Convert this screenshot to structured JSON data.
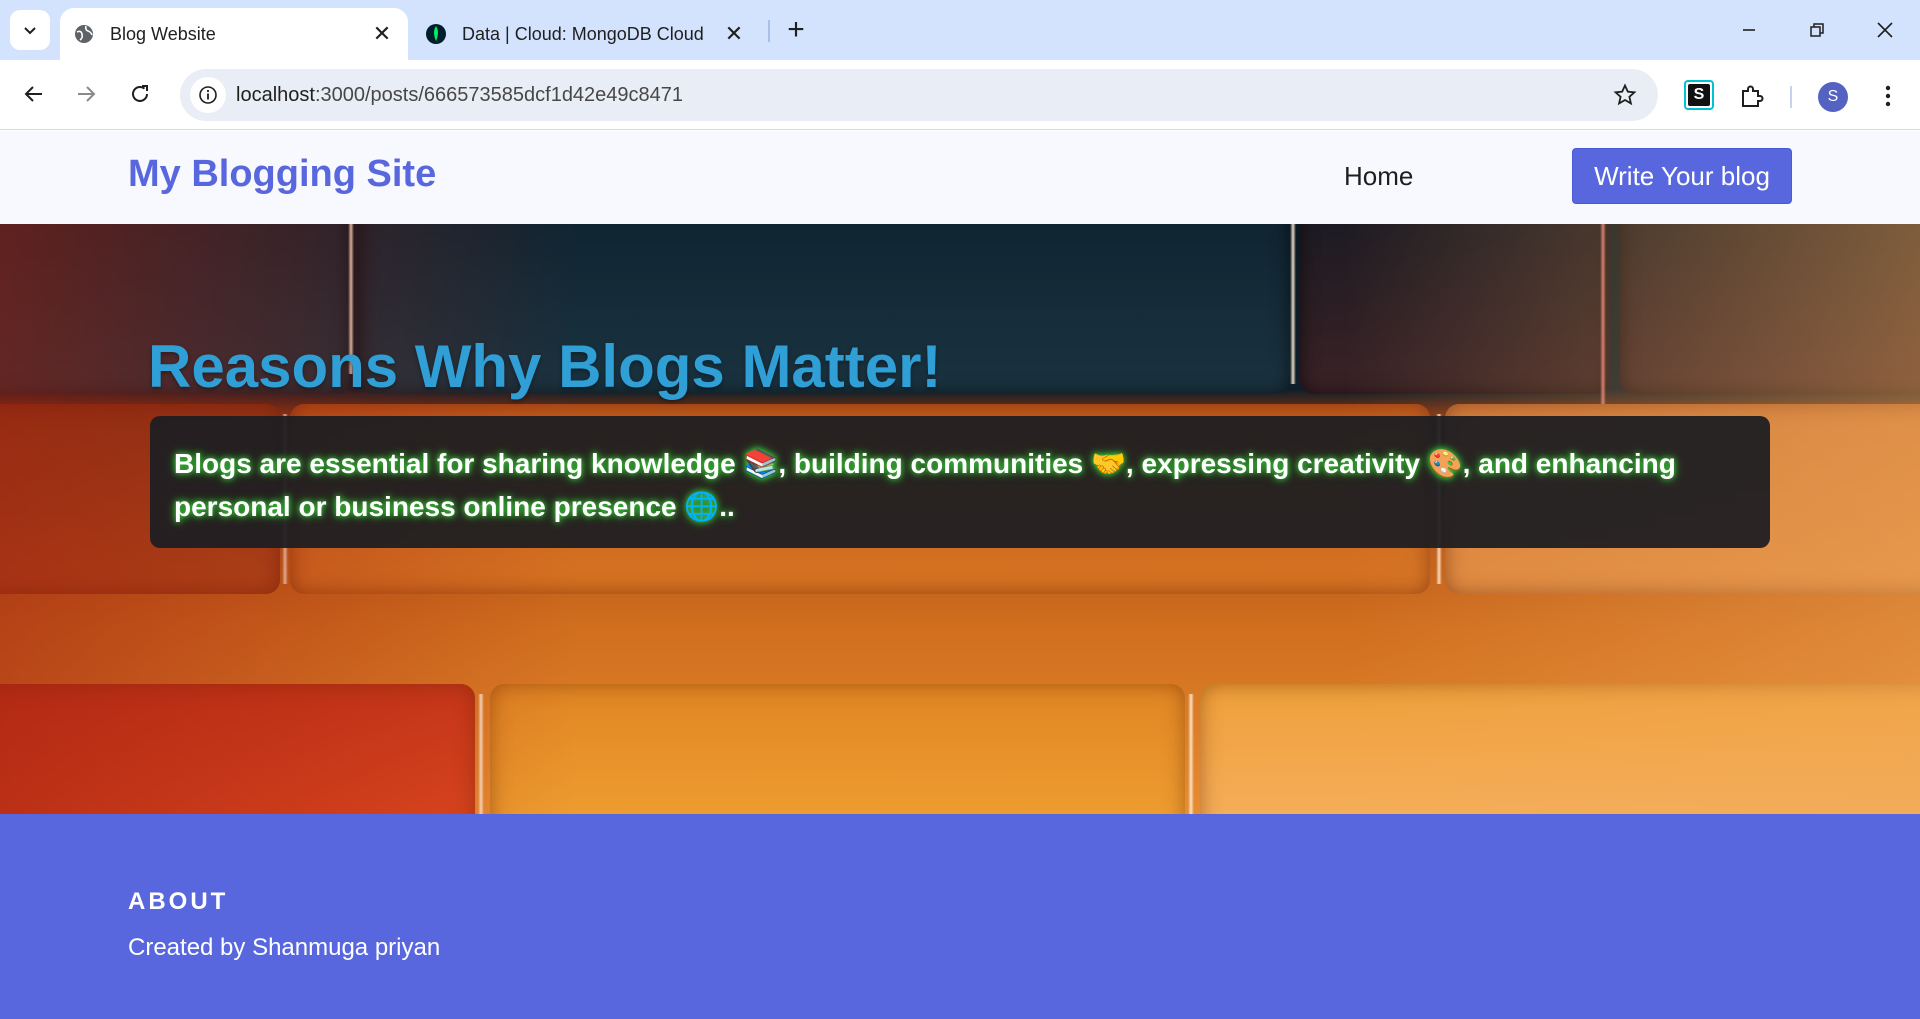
{
  "browser": {
    "tabs": [
      {
        "title": "Blog Website",
        "favicon": "globe-icon",
        "active": true
      },
      {
        "title": "Data | Cloud: MongoDB Cloud",
        "favicon": "mongodb-leaf-icon",
        "active": false
      }
    ],
    "url": {
      "host": "localhost",
      "path": ":3000/posts/666573585dcf1d42e49c8471"
    },
    "profile_initial": "S",
    "extension_label": "S"
  },
  "site": {
    "brand": "My Blogging Site",
    "nav": {
      "home": "Home",
      "write_button": "Write Your blog"
    }
  },
  "post": {
    "title": "Reasons Why Blogs Matter!",
    "body": "Blogs are essential for sharing knowledge 📚, building communities 🤝, expressing creativity 🎨, and enhancing personal or business online presence 🌐.."
  },
  "footer": {
    "heading": "ABOUT",
    "text": "Created by Shanmuga priyan"
  },
  "colors": {
    "accent": "#5867dd",
    "title": "#2f9fd6",
    "tabstrip": "#d3e3fd"
  }
}
